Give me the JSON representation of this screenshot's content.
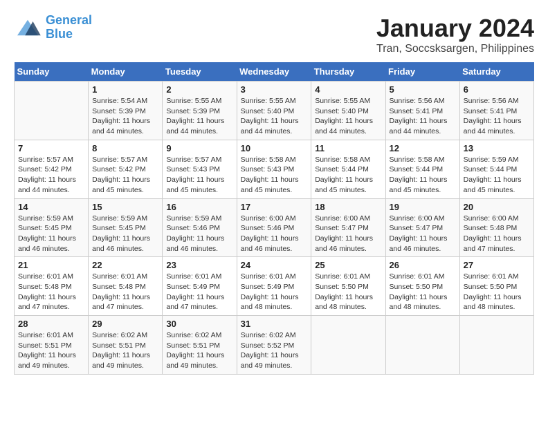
{
  "logo": {
    "line1": "General",
    "line2": "Blue"
  },
  "title": "January 2024",
  "subtitle": "Tran, Soccsksargen, Philippines",
  "days_of_week": [
    "Sunday",
    "Monday",
    "Tuesday",
    "Wednesday",
    "Thursday",
    "Friday",
    "Saturday"
  ],
  "weeks": [
    [
      {
        "day": "",
        "sunrise": "",
        "sunset": "",
        "daylight": ""
      },
      {
        "day": "1",
        "sunrise": "Sunrise: 5:54 AM",
        "sunset": "Sunset: 5:39 PM",
        "daylight": "Daylight: 11 hours and 44 minutes."
      },
      {
        "day": "2",
        "sunrise": "Sunrise: 5:55 AM",
        "sunset": "Sunset: 5:39 PM",
        "daylight": "Daylight: 11 hours and 44 minutes."
      },
      {
        "day": "3",
        "sunrise": "Sunrise: 5:55 AM",
        "sunset": "Sunset: 5:40 PM",
        "daylight": "Daylight: 11 hours and 44 minutes."
      },
      {
        "day": "4",
        "sunrise": "Sunrise: 5:55 AM",
        "sunset": "Sunset: 5:40 PM",
        "daylight": "Daylight: 11 hours and 44 minutes."
      },
      {
        "day": "5",
        "sunrise": "Sunrise: 5:56 AM",
        "sunset": "Sunset: 5:41 PM",
        "daylight": "Daylight: 11 hours and 44 minutes."
      },
      {
        "day": "6",
        "sunrise": "Sunrise: 5:56 AM",
        "sunset": "Sunset: 5:41 PM",
        "daylight": "Daylight: 11 hours and 44 minutes."
      }
    ],
    [
      {
        "day": "7",
        "sunrise": "Sunrise: 5:57 AM",
        "sunset": "Sunset: 5:42 PM",
        "daylight": "Daylight: 11 hours and 44 minutes."
      },
      {
        "day": "8",
        "sunrise": "Sunrise: 5:57 AM",
        "sunset": "Sunset: 5:42 PM",
        "daylight": "Daylight: 11 hours and 45 minutes."
      },
      {
        "day": "9",
        "sunrise": "Sunrise: 5:57 AM",
        "sunset": "Sunset: 5:43 PM",
        "daylight": "Daylight: 11 hours and 45 minutes."
      },
      {
        "day": "10",
        "sunrise": "Sunrise: 5:58 AM",
        "sunset": "Sunset: 5:43 PM",
        "daylight": "Daylight: 11 hours and 45 minutes."
      },
      {
        "day": "11",
        "sunrise": "Sunrise: 5:58 AM",
        "sunset": "Sunset: 5:44 PM",
        "daylight": "Daylight: 11 hours and 45 minutes."
      },
      {
        "day": "12",
        "sunrise": "Sunrise: 5:58 AM",
        "sunset": "Sunset: 5:44 PM",
        "daylight": "Daylight: 11 hours and 45 minutes."
      },
      {
        "day": "13",
        "sunrise": "Sunrise: 5:59 AM",
        "sunset": "Sunset: 5:44 PM",
        "daylight": "Daylight: 11 hours and 45 minutes."
      }
    ],
    [
      {
        "day": "14",
        "sunrise": "Sunrise: 5:59 AM",
        "sunset": "Sunset: 5:45 PM",
        "daylight": "Daylight: 11 hours and 46 minutes."
      },
      {
        "day": "15",
        "sunrise": "Sunrise: 5:59 AM",
        "sunset": "Sunset: 5:45 PM",
        "daylight": "Daylight: 11 hours and 46 minutes."
      },
      {
        "day": "16",
        "sunrise": "Sunrise: 5:59 AM",
        "sunset": "Sunset: 5:46 PM",
        "daylight": "Daylight: 11 hours and 46 minutes."
      },
      {
        "day": "17",
        "sunrise": "Sunrise: 6:00 AM",
        "sunset": "Sunset: 5:46 PM",
        "daylight": "Daylight: 11 hours and 46 minutes."
      },
      {
        "day": "18",
        "sunrise": "Sunrise: 6:00 AM",
        "sunset": "Sunset: 5:47 PM",
        "daylight": "Daylight: 11 hours and 46 minutes."
      },
      {
        "day": "19",
        "sunrise": "Sunrise: 6:00 AM",
        "sunset": "Sunset: 5:47 PM",
        "daylight": "Daylight: 11 hours and 46 minutes."
      },
      {
        "day": "20",
        "sunrise": "Sunrise: 6:00 AM",
        "sunset": "Sunset: 5:48 PM",
        "daylight": "Daylight: 11 hours and 47 minutes."
      }
    ],
    [
      {
        "day": "21",
        "sunrise": "Sunrise: 6:01 AM",
        "sunset": "Sunset: 5:48 PM",
        "daylight": "Daylight: 11 hours and 47 minutes."
      },
      {
        "day": "22",
        "sunrise": "Sunrise: 6:01 AM",
        "sunset": "Sunset: 5:48 PM",
        "daylight": "Daylight: 11 hours and 47 minutes."
      },
      {
        "day": "23",
        "sunrise": "Sunrise: 6:01 AM",
        "sunset": "Sunset: 5:49 PM",
        "daylight": "Daylight: 11 hours and 47 minutes."
      },
      {
        "day": "24",
        "sunrise": "Sunrise: 6:01 AM",
        "sunset": "Sunset: 5:49 PM",
        "daylight": "Daylight: 11 hours and 48 minutes."
      },
      {
        "day": "25",
        "sunrise": "Sunrise: 6:01 AM",
        "sunset": "Sunset: 5:50 PM",
        "daylight": "Daylight: 11 hours and 48 minutes."
      },
      {
        "day": "26",
        "sunrise": "Sunrise: 6:01 AM",
        "sunset": "Sunset: 5:50 PM",
        "daylight": "Daylight: 11 hours and 48 minutes."
      },
      {
        "day": "27",
        "sunrise": "Sunrise: 6:01 AM",
        "sunset": "Sunset: 5:50 PM",
        "daylight": "Daylight: 11 hours and 48 minutes."
      }
    ],
    [
      {
        "day": "28",
        "sunrise": "Sunrise: 6:01 AM",
        "sunset": "Sunset: 5:51 PM",
        "daylight": "Daylight: 11 hours and 49 minutes."
      },
      {
        "day": "29",
        "sunrise": "Sunrise: 6:02 AM",
        "sunset": "Sunset: 5:51 PM",
        "daylight": "Daylight: 11 hours and 49 minutes."
      },
      {
        "day": "30",
        "sunrise": "Sunrise: 6:02 AM",
        "sunset": "Sunset: 5:51 PM",
        "daylight": "Daylight: 11 hours and 49 minutes."
      },
      {
        "day": "31",
        "sunrise": "Sunrise: 6:02 AM",
        "sunset": "Sunset: 5:52 PM",
        "daylight": "Daylight: 11 hours and 49 minutes."
      },
      {
        "day": "",
        "sunrise": "",
        "sunset": "",
        "daylight": ""
      },
      {
        "day": "",
        "sunrise": "",
        "sunset": "",
        "daylight": ""
      },
      {
        "day": "",
        "sunrise": "",
        "sunset": "",
        "daylight": ""
      }
    ]
  ]
}
